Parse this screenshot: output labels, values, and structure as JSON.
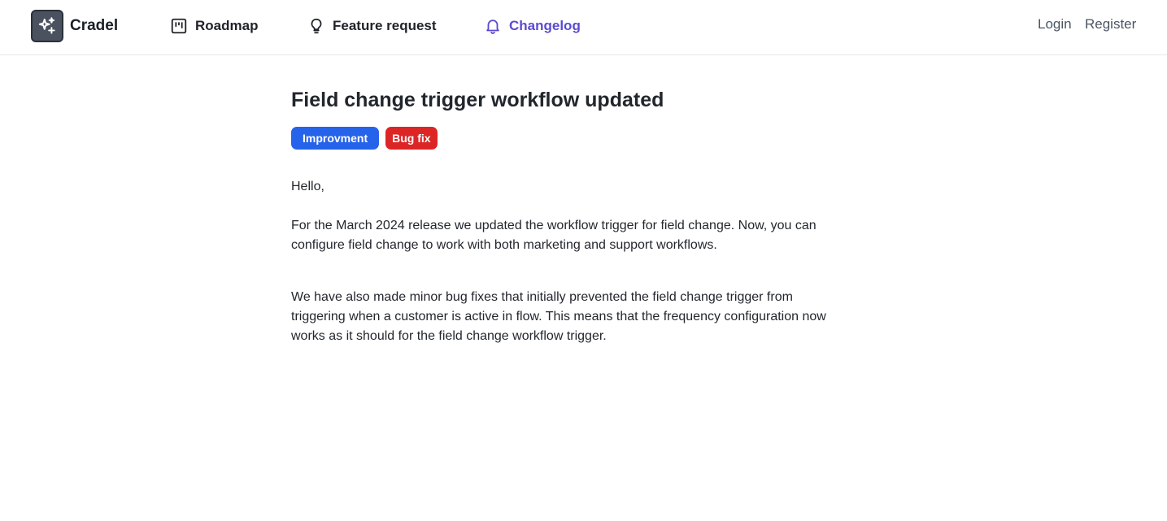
{
  "header": {
    "brand_name": "Cradel",
    "nav": [
      {
        "label": "Roadmap",
        "icon": "kanban-board-icon"
      },
      {
        "label": "Feature request",
        "icon": "lightbulb-icon"
      },
      {
        "label": "Changelog",
        "icon": "bell-icon",
        "active": true
      }
    ],
    "login_label": "Login",
    "register_label": "Register"
  },
  "article": {
    "title": "Field change trigger workflow updated",
    "tags": [
      {
        "label": "Improvment",
        "color": "#2563eb"
      },
      {
        "label": "Bug fix",
        "color": "#dc2626"
      }
    ],
    "greeting": "Hello,",
    "paragraph_1": "For the March 2024 release we updated the workflow trigger for field change. Now, you can configure field change to work with both marketing and support workflows.",
    "paragraph_2": "We have also made minor bug fixes that initially prevented the field change trigger from triggering when a customer is active in flow. This means that the frequency configuration now works as it should for the field change workflow trigger."
  },
  "colors": {
    "accent": "#5a4bd1",
    "logo_bg": "#4a5260"
  }
}
